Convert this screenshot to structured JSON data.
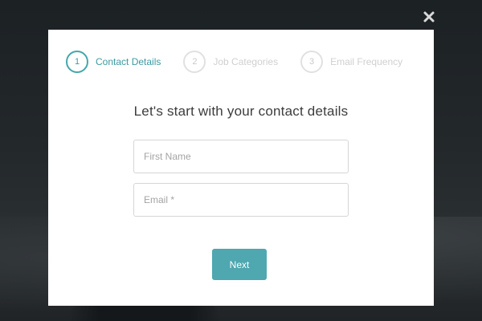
{
  "modal": {
    "steps": [
      {
        "number": "1",
        "label": "Contact Details",
        "state": "active"
      },
      {
        "number": "2",
        "label": "Job Categories",
        "state": "inactive"
      },
      {
        "number": "3",
        "label": "Email Frequency",
        "state": "inactive"
      }
    ],
    "heading": "Let's start with your contact details",
    "fields": {
      "first_name": {
        "placeholder": "First Name",
        "value": ""
      },
      "email": {
        "placeholder": "Email *",
        "value": ""
      }
    },
    "next_label": "Next"
  },
  "icons": {
    "close": "close-icon"
  },
  "colors": {
    "accent": "#4fa7b0",
    "active_step": "#3c9aa0",
    "inactive_step": "#d0d0d0",
    "backdrop": "#1f2326"
  }
}
